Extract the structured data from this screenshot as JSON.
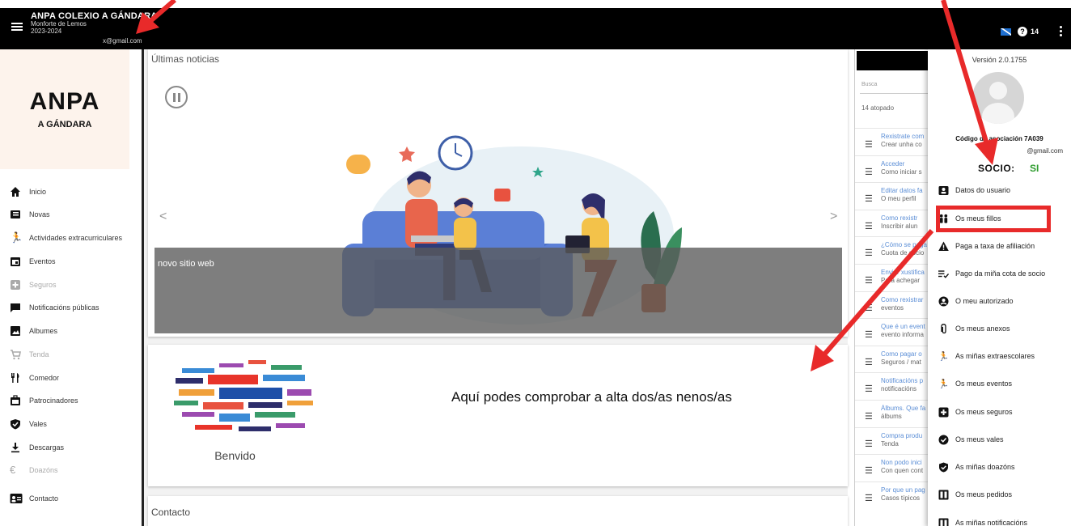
{
  "header": {
    "app_title": "ANPA COLEXIO A GÁNDARA",
    "location": "Monforte de Lemos",
    "school_year": "2023-2024",
    "email": "x@gmail.com",
    "help_count": "14"
  },
  "logo": {
    "main": "ANPA",
    "sub": "A GÁNDARA"
  },
  "sidebar": {
    "items": [
      {
        "label": "Inicio",
        "icon": "home-icon",
        "enabled": true
      },
      {
        "label": "Novas",
        "icon": "news-icon",
        "enabled": true
      },
      {
        "label": "Actividades extracurriculares",
        "icon": "running-person-icon",
        "enabled": true
      },
      {
        "label": "Eventos",
        "icon": "calendar-icon",
        "enabled": true
      },
      {
        "label": "Seguros",
        "icon": "medical-plus-icon",
        "enabled": false
      },
      {
        "label": "Notificacións públicas",
        "icon": "message-icon",
        "enabled": true
      },
      {
        "label": "Albumes",
        "icon": "image-icon",
        "enabled": true
      },
      {
        "label": "Tenda",
        "icon": "cart-icon",
        "enabled": false
      },
      {
        "label": "Comedor",
        "icon": "cutlery-icon",
        "enabled": true
      },
      {
        "label": "Patrocinadores",
        "icon": "sponsor-icon",
        "enabled": true
      },
      {
        "label": "Vales",
        "icon": "shield-check-icon",
        "enabled": true
      },
      {
        "label": "Descargas",
        "icon": "download-icon",
        "enabled": true
      },
      {
        "label": "Doazóns",
        "icon": "euro-icon",
        "enabled": false
      },
      {
        "label": "Contacto",
        "icon": "contact-card-icon",
        "enabled": true
      }
    ]
  },
  "news": {
    "title": "Últimas noticias",
    "prev": "<",
    "next": ">",
    "slide_caption": "novo sitio web"
  },
  "welcome": {
    "label": "Benvido",
    "annotation": "Aquí podes comprobar a alta dos/as nenos/as"
  },
  "contact": {
    "title": "Contacto"
  },
  "faq": {
    "search_label": "Busca",
    "count": "14 atopado",
    "items": [
      {
        "title": "Rexistrate com",
        "sub": "Crear unha co"
      },
      {
        "title": "Acceder",
        "sub": "Como iniciar s"
      },
      {
        "title": "Editar datos fa",
        "sub": "O meu perfil"
      },
      {
        "title": "Como rexistr",
        "sub": "Inscribir alun"
      },
      {
        "title": "¿Cómo se paga",
        "sub": "Cuota de socio"
      },
      {
        "title": "Enviar xustifica",
        "sub": "Para achegar"
      },
      {
        "title": "Como rexistrar",
        "sub": "eventos"
      },
      {
        "title": "Que é un event",
        "sub": "evento informa"
      },
      {
        "title": "Como pagar o",
        "sub": "Seguros / mat"
      },
      {
        "title": "Notificacións p",
        "sub": "notificacións"
      },
      {
        "title": "Álbums. Que fa",
        "sub": "álbums"
      },
      {
        "title": "Compra produ",
        "sub": "Tenda"
      },
      {
        "title": "Non podo inici",
        "sub": "Con quen cont"
      },
      {
        "title": "Por que un pag",
        "sub": "Casos típicos"
      }
    ]
  },
  "user_menu": {
    "version": "Versión 2.0.1755",
    "association_code": "Código de asociación 7A039",
    "email": "@gmail.com",
    "socio_label": "SOCIO:",
    "socio_value": "SI",
    "items": [
      {
        "label": "Datos do usuario",
        "icon": "id-card-icon"
      },
      {
        "label": "Os meus fillos",
        "icon": "children-icon"
      },
      {
        "label": "Paga a taxa de afiliación",
        "icon": "warning-icon"
      },
      {
        "label": "Pago da miña cota de socio",
        "icon": "list-check-icon"
      },
      {
        "label": "O meu autorizado",
        "icon": "account-circle-icon"
      },
      {
        "label": "Os meus anexos",
        "icon": "paperclip-icon"
      },
      {
        "label": "As miñas extraescolares",
        "icon": "running-person-icon"
      },
      {
        "label": "Os meus eventos",
        "icon": "running-person-icon"
      },
      {
        "label": "Os meus seguros",
        "icon": "medical-plus-icon"
      },
      {
        "label": "Os meus vales",
        "icon": "shield-check-icon"
      },
      {
        "label": "As miñas doazóns",
        "icon": "shield-check-icon"
      },
      {
        "label": "Os meus pedidos",
        "icon": "book-icon"
      },
      {
        "label": "As miñas notificacións",
        "icon": "book-icon"
      }
    ]
  },
  "colors": {
    "highlight": "#e82a2a",
    "socio_value": "#2e9c2e",
    "faq_link": "#5b8ed6"
  }
}
